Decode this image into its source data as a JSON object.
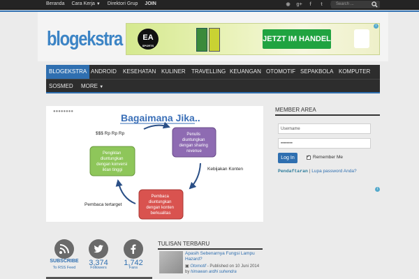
{
  "topbar": {
    "nav": [
      "Beranda",
      "Cara Kerja",
      "Direktori Grup",
      "JOIN"
    ],
    "search_placeholder": "Search ..."
  },
  "header": {
    "logo": "blogekstra",
    "ad": {
      "brand": "EA",
      "brand_sub": "SPORTS",
      "cta": "JETZT IM HANDEL"
    }
  },
  "mainnav": {
    "row1": [
      "BLOGEKSTRA",
      "ANDROID",
      "KESEHATAN",
      "KULINER",
      "TRAVELLING",
      "KEUANGAN",
      "OTOMOTIF",
      "SEPAKBOLA",
      "KOMPUTER"
    ],
    "row2": [
      "SOSMED",
      "MORE"
    ],
    "active": "BLOGEKSTRA"
  },
  "diagram": {
    "title": "Bagaimana Jika..",
    "dots": "●●●●●●●●",
    "money": "$$$ Rp Rp Rp",
    "node_writer": [
      "Penulis",
      "diuntungkan",
      "dengan sharing",
      "revenue"
    ],
    "node_advertiser": [
      "Pengiklan",
      "diuntungkan",
      "dengan konversi",
      "iklan tinggi"
    ],
    "node_reader": [
      "Pembaca",
      "diuntungkan",
      "dengan konten",
      "berkualitas"
    ],
    "label_policy": "Kebijakan Konten",
    "label_reader": "Pembaca tertarget",
    "colors": {
      "writer": "#8e6bb2",
      "advertiser": "#8ec65a",
      "reader": "#d9534f",
      "arrow": "#2a4f86",
      "title": "#3a6fb7"
    }
  },
  "member": {
    "title": "MEMBER AREA",
    "username_placeholder": "Username",
    "password_value": "••••••••",
    "login_label": "Log In",
    "remember_label": "Remember Me",
    "register_link": "Pendaftaran",
    "separator": "|",
    "forgot_link": "Lupa password Anda?"
  },
  "social": {
    "rss": {
      "line1": "SUBSCRIBE",
      "line2": "To RSS Feed"
    },
    "twitter": {
      "count": "3,374",
      "label": "Followers"
    },
    "facebook": {
      "count": "1,742",
      "label": "Fans"
    }
  },
  "recent": {
    "title": "TULISAN TERBARU",
    "post_title": "Apasih Sebenarnya Fungsi Lampu Hazard?",
    "post_category": "Otomotif",
    "post_published": " - Published on 10 Juni 2014 by ",
    "post_author": "himawan ardhi suhendra"
  }
}
